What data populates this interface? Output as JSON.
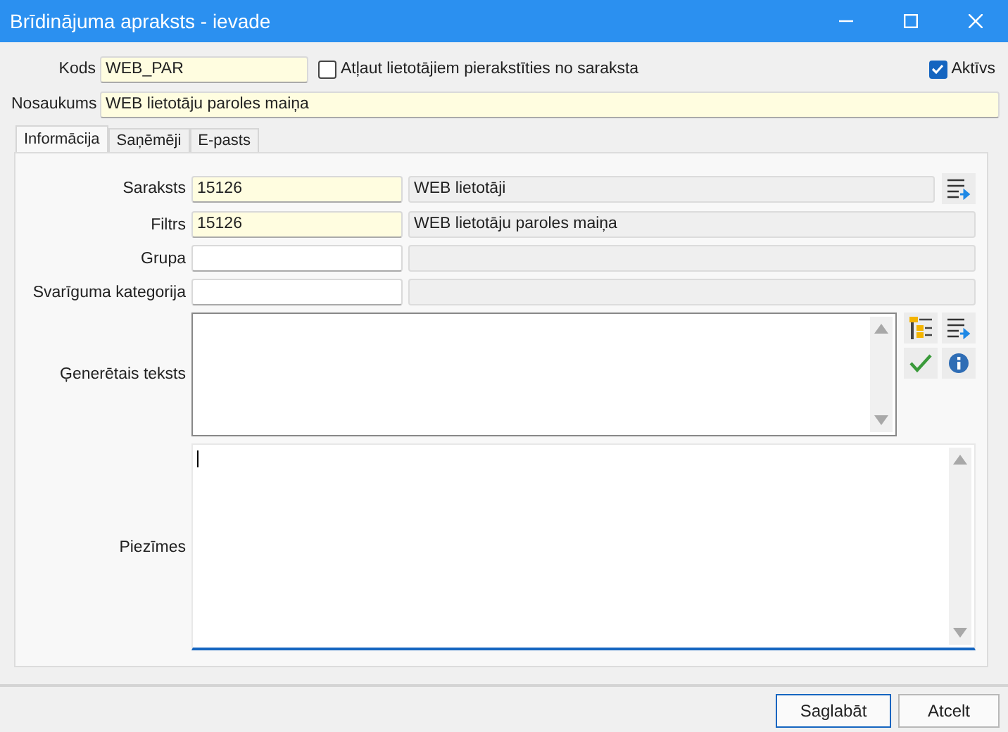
{
  "window": {
    "title": "Brīdinājuma apraksts - ievade"
  },
  "header": {
    "code_label": "Kods",
    "code": "WEB_PAR",
    "code_required": true,
    "allow_self_signup": {
      "label": "Atļaut lietotājiem pierakstīties no saraksta",
      "checked": false
    },
    "active": {
      "label": "Aktīvs",
      "checked": true
    },
    "name_label": "Nosaukums",
    "name": "WEB lietotāju paroles maiņa",
    "name_required": true
  },
  "tabs": [
    {
      "label": "Informācija",
      "selected": true
    },
    {
      "label": "Saņēmēji",
      "selected": false
    },
    {
      "label": "E-pasts",
      "selected": false
    }
  ],
  "info_fields": [
    {
      "label": "Saraksts",
      "code": "15126",
      "name": "WEB lietotāji",
      "required": true,
      "kind": "with-button"
    },
    {
      "label": "Filtrs",
      "code": "15126",
      "name": "WEB lietotāju paroles maiņa",
      "required": true,
      "kind": "plain"
    },
    {
      "label": "Grupa",
      "required": false,
      "kind": "plain"
    },
    {
      "label": "Svarīguma kategorija",
      "required": false,
      "kind": "plain"
    }
  ],
  "generated_text": {
    "label": "Ģenerētais teksts"
  },
  "notes": {
    "label": "Piezīmes",
    "focused": true
  },
  "buttons": [
    {
      "label": "Saglabāt",
      "default": true
    },
    {
      "label": "Atcelt",
      "default": false
    }
  ]
}
